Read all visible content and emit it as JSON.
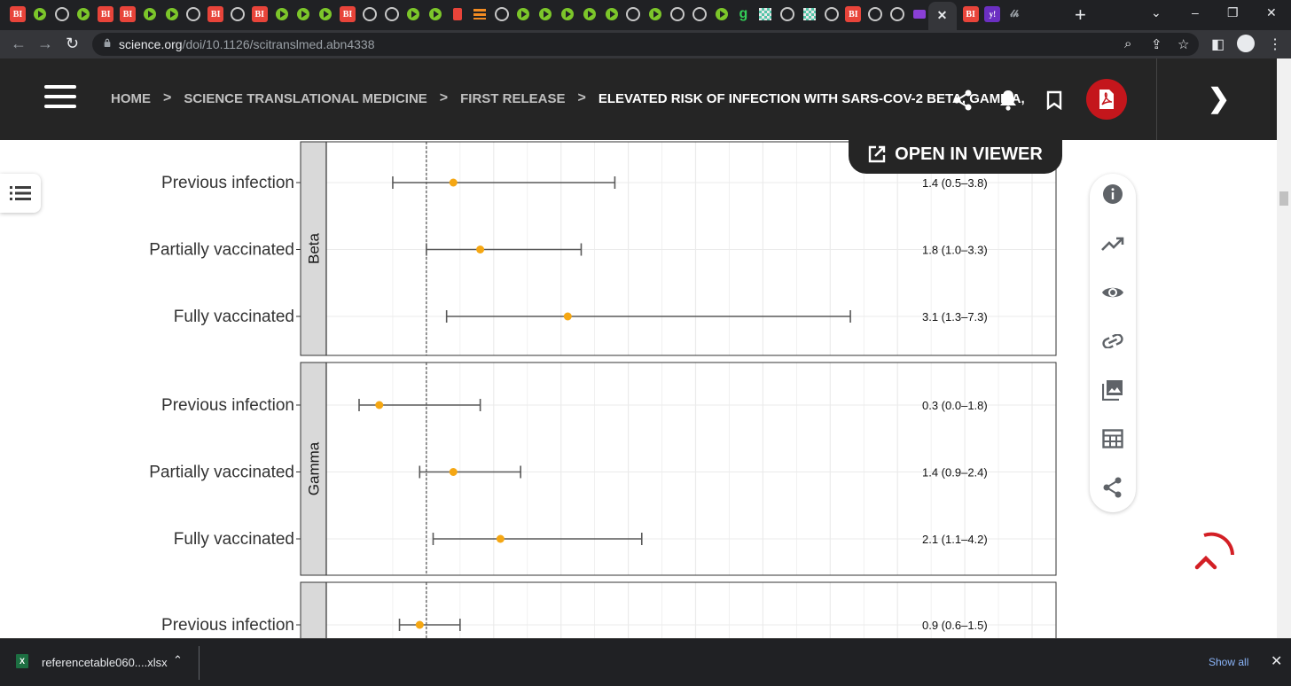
{
  "browser": {
    "tabs": [
      "BI",
      "play",
      "globe",
      "play",
      "BI",
      "BI",
      "play",
      "play",
      "globe",
      "BI",
      "globe",
      "BI",
      "play",
      "play",
      "play",
      "BI",
      "globe",
      "globe",
      "play",
      "play",
      "red",
      "orange",
      "globe",
      "play",
      "play",
      "play",
      "play",
      "play",
      "globe",
      "play",
      "globe",
      "globe",
      "play",
      "g",
      "mosaic",
      "globe",
      "mosaic",
      "globe",
      "BI",
      "globe",
      "globe",
      "purple2",
      "active",
      "BI",
      "purple",
      "script"
    ],
    "tab_labels": {
      "bi": "BI",
      "g": "g",
      "yahoo": "y!",
      "script": "𝓁𝒽"
    },
    "active_tab_close": "✕",
    "new_tab": "+",
    "window_controls": [
      "⌄",
      "–",
      "❐",
      "✕"
    ],
    "url_host": "science.org",
    "url_path": "/doi/10.1126/scitranslmed.abn4338"
  },
  "site": {
    "breadcrumb": [
      {
        "label": "HOME"
      },
      {
        "label": "SCIENCE TRANSLATIONAL MEDICINE"
      },
      {
        "label": "FIRST RELEASE"
      },
      {
        "label": "ELEVATED RISK OF INFECTION WITH SARS-COV-2 BETA, GAMMA,"
      }
    ],
    "breadcrumb_separator": ">",
    "open_in_viewer": "OPEN IN VIEWER",
    "pdf_label": "PDF"
  },
  "side_rail": [
    "info-icon",
    "trending-icon",
    "eye-icon",
    "link-icon",
    "image-icon",
    "table-icon",
    "share-icon"
  ],
  "downloads": {
    "file_name": "referencetable060....xlsx",
    "file_badge": "X",
    "show_all": "Show all"
  },
  "chart_data": {
    "type": "forest",
    "reference_line": 1,
    "xlim": [
      0,
      10
    ],
    "panels": [
      {
        "strip": "Beta",
        "rows": [
          {
            "label": "Previous infection",
            "estimate": 1.4,
            "lower": 0.5,
            "upper": 3.8,
            "text": "1.4 (0.5–3.8)"
          },
          {
            "label": "Partially vaccinated",
            "estimate": 1.8,
            "lower": 1.0,
            "upper": 3.3,
            "text": "1.8 (1.0–3.3)"
          },
          {
            "label": "Fully vaccinated",
            "estimate": 3.1,
            "lower": 1.3,
            "upper": 7.3,
            "text": "3.1 (1.3–7.3)"
          }
        ]
      },
      {
        "strip": "Gamma",
        "rows": [
          {
            "label": "Previous infection",
            "estimate": 0.3,
            "lower": 0.0,
            "upper": 1.8,
            "text": "0.3 (0.0–1.8)"
          },
          {
            "label": "Partially vaccinated",
            "estimate": 1.4,
            "lower": 0.9,
            "upper": 2.4,
            "text": "1.4 (0.9–2.4)"
          },
          {
            "label": "Fully vaccinated",
            "estimate": 2.1,
            "lower": 1.1,
            "upper": 4.2,
            "text": "2.1 (1.1–4.2)"
          }
        ]
      },
      {
        "strip": "",
        "rows": [
          {
            "label": "Previous infection",
            "estimate": 0.9,
            "lower": 0.6,
            "upper": 1.5,
            "text": "0.9 (0.6–1.5)"
          }
        ]
      }
    ],
    "colors": {
      "point": "#f5a713",
      "whisker": "#595959",
      "strip": "#d9d9d9",
      "grid": "#ebebeb"
    }
  }
}
